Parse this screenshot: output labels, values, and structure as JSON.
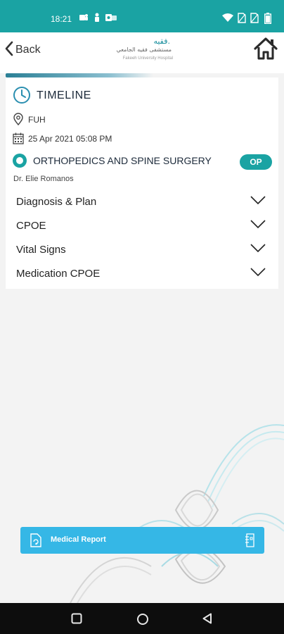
{
  "status_bar": {
    "time": "18:21",
    "bg_color": "#1aa3a3",
    "notification_icons": [
      "teams-icon",
      "person-icon",
      "outlook-icon"
    ],
    "system_icons": [
      "wifi-icon",
      "no-sim-icon",
      "no-sim-icon",
      "battery-icon"
    ]
  },
  "header": {
    "back_label": "Back",
    "logo": {
      "arabic_mark": "فقيه.",
      "arabic_name": "مستشفى فقيه الجامعي",
      "latin_name": "Fakeeh University Hospital"
    }
  },
  "timeline": {
    "title": "TIMELINE",
    "location": "FUH",
    "datetime": "25 Apr 2021 05:08 PM",
    "department": "ORTHOPEDICS AND SPINE SURGERY",
    "badge": "OP",
    "doctor": "Dr. Elie Romanos",
    "sections": [
      {
        "label": "Diagnosis & Plan"
      },
      {
        "label": "CPOE"
      },
      {
        "label": "Vital Signs"
      },
      {
        "label": "Medication CPOE"
      }
    ]
  },
  "medical_report_button": {
    "label": "Medical Report",
    "color": "#35b7e6"
  },
  "colors": {
    "accent": "#1aa3a3"
  }
}
